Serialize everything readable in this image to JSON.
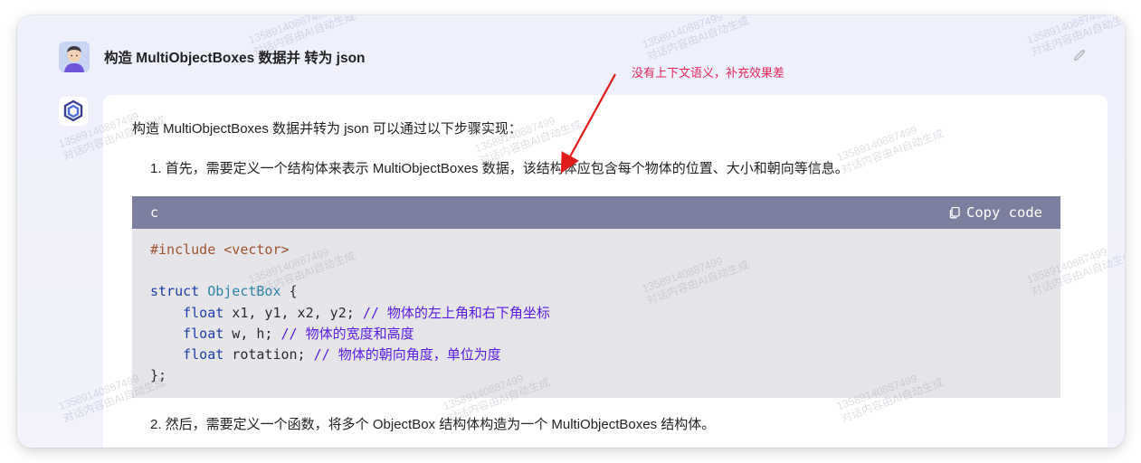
{
  "user": {
    "avatar_icon": "person-avatar-icon",
    "question": "构造 MultiObjectBoxes 数据并 转为 json"
  },
  "answer": {
    "bot_icon": "chatgpt-logo-icon",
    "intro": "构造 MultiObjectBoxes 数据并转为 json 可以通过以下步骤实现：",
    "step1": "1. 首先，需要定义一个结构体来表示 MultiObjectBoxes 数据，该结构体应包含每个物体的位置、大小和朝向等信息。",
    "code": {
      "language": "c",
      "copy_label": "Copy code",
      "lines": [
        [
          {
            "t": "#include <vector>",
            "c": "pre"
          }
        ],
        [],
        [
          {
            "t": "struct ",
            "c": "kw"
          },
          {
            "t": "ObjectBox",
            "c": "type"
          },
          {
            "t": " {",
            "c": ""
          }
        ],
        [
          {
            "t": "    ",
            "c": ""
          },
          {
            "t": "float",
            "c": "kw"
          },
          {
            "t": " x1, y1, x2, y2; ",
            "c": ""
          },
          {
            "t": "// 物体的左上角和右下角坐标",
            "c": "cm"
          }
        ],
        [
          {
            "t": "    ",
            "c": ""
          },
          {
            "t": "float",
            "c": "kw"
          },
          {
            "t": " w, h; ",
            "c": ""
          },
          {
            "t": "// 物体的宽度和高度",
            "c": "cm"
          }
        ],
        [
          {
            "t": "    ",
            "c": ""
          },
          {
            "t": "float",
            "c": "kw"
          },
          {
            "t": " rotation; ",
            "c": ""
          },
          {
            "t": "// 物体的朝向角度，单位为度",
            "c": "cm"
          }
        ],
        [
          {
            "t": "};",
            "c": ""
          }
        ]
      ]
    },
    "step2": "2. 然后，需要定义一个函数，将多个 ObjectBox 结构体构造为一个 MultiObjectBoxes 结构体。"
  },
  "annotation": {
    "text": "没有上下文语义，补充效果差",
    "color": "#e4265a"
  },
  "watermark": {
    "line1": "13589140887499",
    "line2": "对话内容由AI自动生成"
  },
  "colors": {
    "code_header": "#7c7f9e",
    "code_bg": "#e5e5ea",
    "keyword": "#1e3fa8",
    "type": "#2a84a8",
    "comment": "#5a1ce0",
    "preprocessor": "#a0522d"
  }
}
